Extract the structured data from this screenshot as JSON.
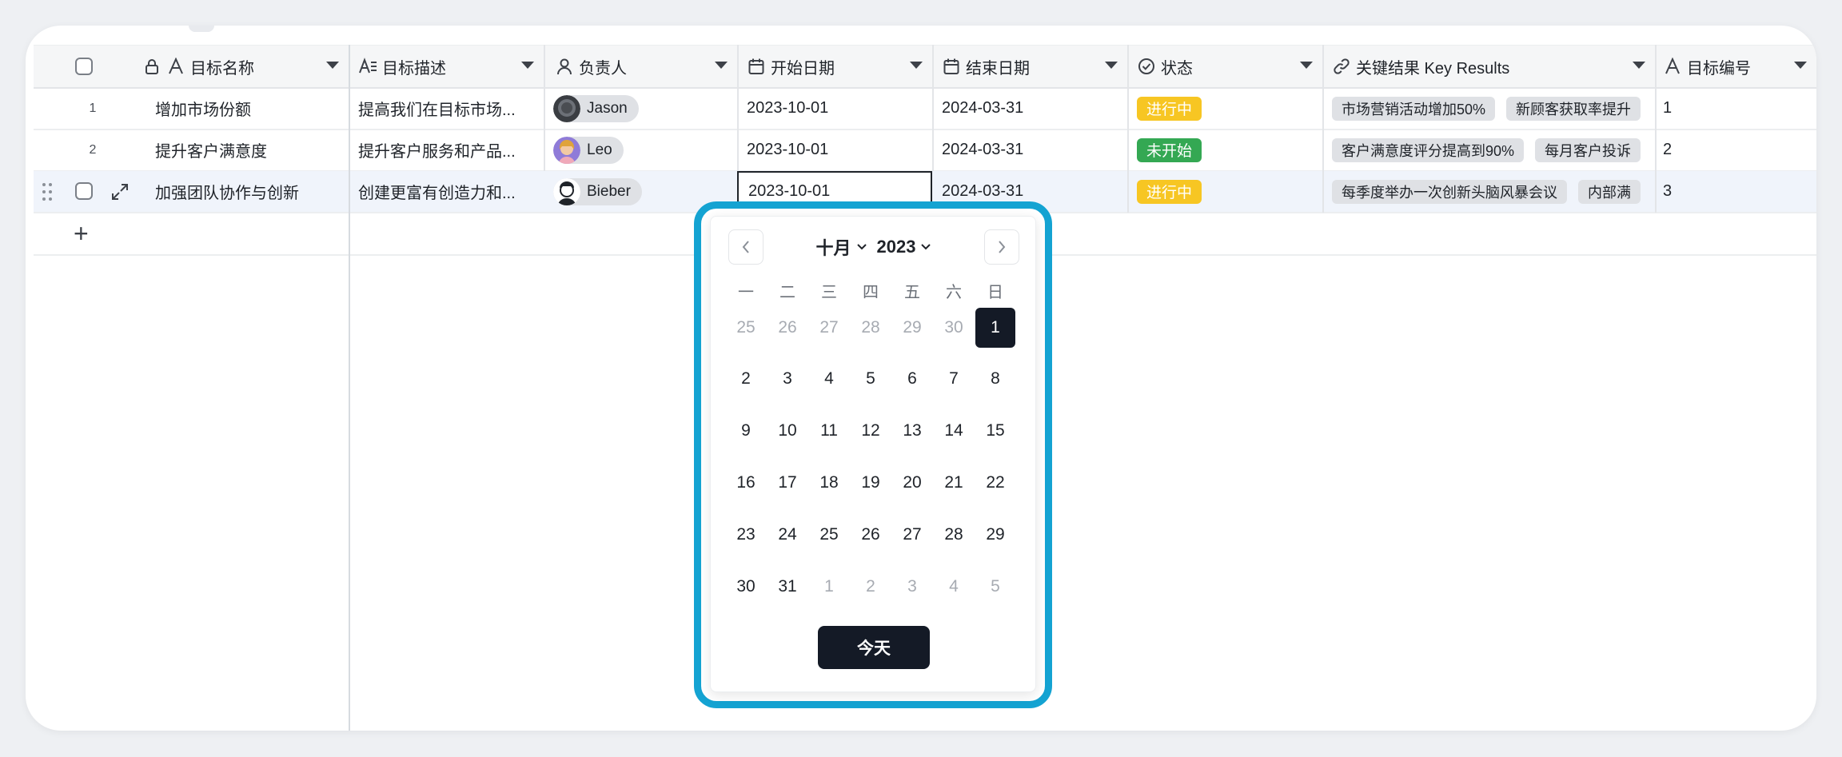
{
  "columns": [
    {
      "label": "目标名称",
      "icon": "text-icon"
    },
    {
      "label": "目标描述",
      "icon": "description-icon"
    },
    {
      "label": "负责人",
      "icon": "person-icon"
    },
    {
      "label": "开始日期",
      "icon": "calendar-icon"
    },
    {
      "label": "结束日期",
      "icon": "calendar-icon"
    },
    {
      "label": "状态",
      "icon": "status-check-icon"
    },
    {
      "label": "关键结果 Key Results",
      "icon": "link-icon"
    },
    {
      "label": "目标编号",
      "icon": "text-icon"
    }
  ],
  "rows": [
    {
      "num": "1",
      "name": "增加市场份额",
      "desc": "提高我们在目标市场...",
      "owner": "Jason",
      "start": "2023-10-01",
      "end": "2024-03-31",
      "status": "进行中",
      "status_color": "#f7c623",
      "results": [
        "市场营销活动增加50%",
        "新顾客获取率提升"
      ],
      "code": "1"
    },
    {
      "num": "2",
      "name": "提升客户满意度",
      "desc": "提升客户服务和产品...",
      "owner": "Leo",
      "start": "2023-10-01",
      "end": "2024-03-31",
      "status": "未开始",
      "status_color": "#34a853",
      "results": [
        "客户满意度评分提高到90%",
        "每月客户投诉"
      ],
      "code": "2"
    },
    {
      "num": "3",
      "name": "加强团队协作与创新",
      "desc": "创建更富有创造力和...",
      "owner": "Bieber",
      "start": "2023-10-01",
      "end": "2024-03-31",
      "status": "进行中",
      "status_color": "#f7c623",
      "results": [
        "每季度举办一次创新头脑风暴会议",
        "内部满"
      ],
      "code": "3"
    }
  ],
  "add_row_label": "+",
  "picker": {
    "month": "十月",
    "year": "2023",
    "weekdays": [
      "一",
      "二",
      "三",
      "四",
      "五",
      "六",
      "日"
    ],
    "weeks": [
      [
        "25",
        "26",
        "27",
        "28",
        "29",
        "30",
        "1"
      ],
      [
        "2",
        "3",
        "4",
        "5",
        "6",
        "7",
        "8"
      ],
      [
        "9",
        "10",
        "11",
        "12",
        "13",
        "14",
        "15"
      ],
      [
        "16",
        "17",
        "18",
        "19",
        "20",
        "21",
        "22"
      ],
      [
        "23",
        "24",
        "25",
        "26",
        "27",
        "28",
        "29"
      ],
      [
        "30",
        "31",
        "1",
        "2",
        "3",
        "4",
        "5"
      ]
    ],
    "muted_first_row": 6,
    "muted_last_from": 2,
    "selected_day": "1",
    "today_label": "今天",
    "accent_color": "#14a3d2"
  }
}
